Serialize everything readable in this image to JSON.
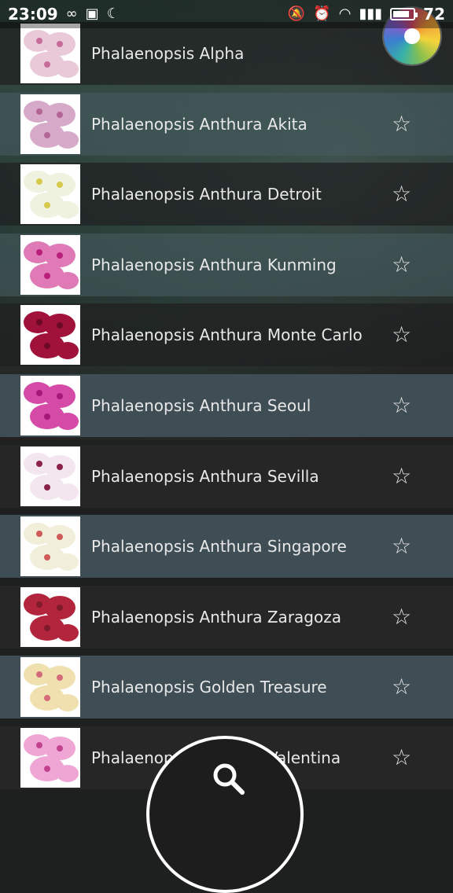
{
  "status_bar": {
    "time": "23:09",
    "battery": "72"
  },
  "list": [
    {
      "name": "Phalaenopsis Alpha",
      "thumb_color": "#e9c8d8",
      "accent": "#c76b9a"
    },
    {
      "name": "Phalaenopsis Anthura Akita",
      "thumb_color": "#d7a9c8",
      "accent": "#b36596"
    },
    {
      "name": "Phalaenopsis Anthura Detroit",
      "thumb_color": "#eef2df",
      "accent": "#d7c94a"
    },
    {
      "name": "Phalaenopsis Anthura Kunming",
      "thumb_color": "#e07ab6",
      "accent": "#b91f7b"
    },
    {
      "name": "Phalaenopsis Anthura Monte Carlo",
      "thumb_color": "#a0123a",
      "accent": "#6b0a25"
    },
    {
      "name": "Phalaenopsis Anthura Seoul",
      "thumb_color": "#d54aa6",
      "accent": "#a7177a"
    },
    {
      "name": "Phalaenopsis Anthura Sevilla",
      "thumb_color": "#f4e6ee",
      "accent": "#8a2149"
    },
    {
      "name": "Phalaenopsis Anthura Singapore",
      "thumb_color": "#f1efd9",
      "accent": "#cf5a5a"
    },
    {
      "name": "Phalaenopsis Anthura Zaragoza",
      "thumb_color": "#b3253c",
      "accent": "#7f1b2b"
    },
    {
      "name": "Phalaenopsis Golden Treasure",
      "thumb_color": "#f0e0b0",
      "accent": "#d46b7a"
    },
    {
      "name": "Phalaenopsis Anthura Valentina",
      "thumb_color": "#f0a6d4",
      "accent": "#c2428f"
    }
  ],
  "icons": {
    "star": "star-outline-icon",
    "search": "search-icon"
  }
}
